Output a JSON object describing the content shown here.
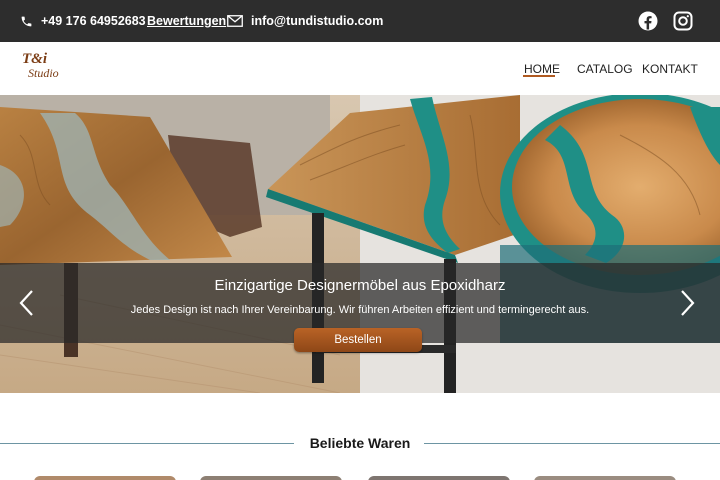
{
  "topbar": {
    "phone": "+49 176 64952683",
    "reviews_link": "Bewertungen",
    "email": "info@tundistudio.com",
    "icons": [
      "phone-icon",
      "mail-icon",
      "facebook-icon",
      "instagram-icon"
    ]
  },
  "header": {
    "logo_line1": "T&i",
    "logo_line2": "Studio",
    "nav": [
      {
        "label": "HOME",
        "active": true
      },
      {
        "label": "CATALOG",
        "active": false
      },
      {
        "label": "KONTAKT",
        "active": false
      }
    ]
  },
  "hero": {
    "title": "Einzigartige Designermöbel aus Epoxidharz",
    "subtitle": "Jedes Design ist nach Ihrer Vereinbarung. Wir führen Arbeiten effizient und termingerecht aus.",
    "button_label": "Bestellen",
    "icons": [
      "chevron-left-icon",
      "chevron-right-icon"
    ]
  },
  "section": {
    "title": "Beliebte Waren"
  },
  "colors": {
    "topbar_bg": "#2d2d2d",
    "accent": "#b05a21",
    "resin": "#1f8f86",
    "rule": "#6d95a3"
  }
}
